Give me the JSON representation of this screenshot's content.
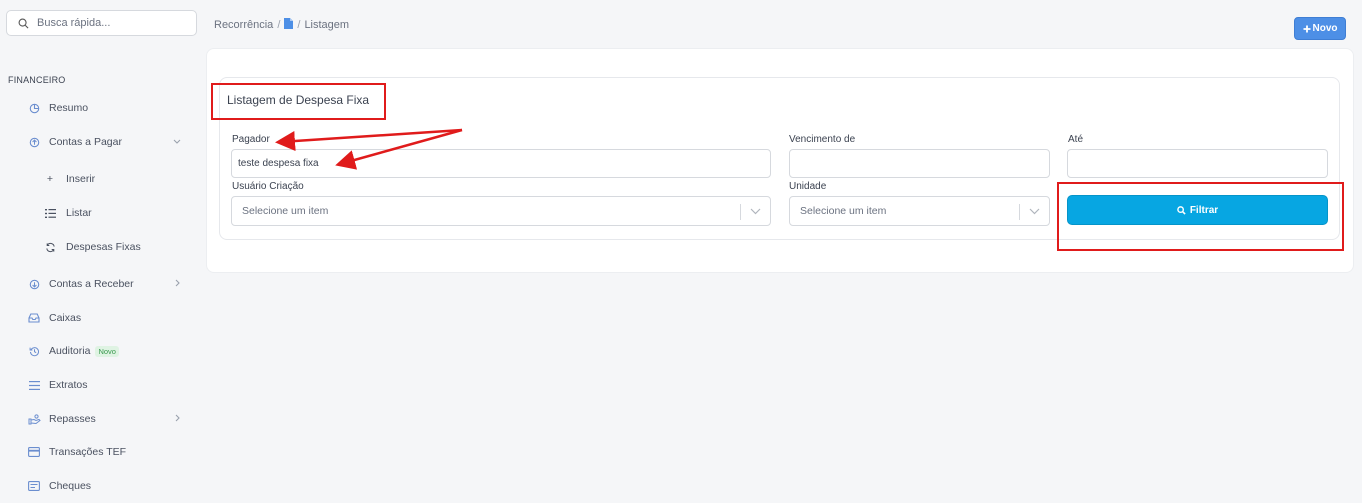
{
  "sidebar": {
    "search_placeholder": "Busca rápida...",
    "section_title": "FINANCEIRO",
    "items": {
      "resumo": "Resumo",
      "contas_pagar": "Contas a Pagar",
      "inserir": "Inserir",
      "listar": "Listar",
      "despesas_fixas": "Despesas Fixas",
      "contas_receber": "Contas a Receber",
      "caixas": "Caixas",
      "auditoria": "Auditoria",
      "auditoria_badge": "Novo",
      "extratos": "Extratos",
      "repasses": "Repasses",
      "transacoes_tef": "Transações TEF",
      "cheques": "Cheques"
    }
  },
  "header": {
    "breadcrumb_1": "Recorrência",
    "breadcrumb_sep": "/",
    "breadcrumb_3": "Listagem",
    "new_button": "Novo"
  },
  "form": {
    "title": "Listagem de Despesa Fixa",
    "pagador_label": "Pagador",
    "pagador_value": "teste despesa fixa",
    "vencimento_label": "Vencimento de",
    "ate_label": "Até",
    "usuario_label": "Usuário Criação",
    "usuario_placeholder": "Selecione um item",
    "unidade_label": "Unidade",
    "unidade_placeholder": "Selecione um item",
    "filter_button": "Filtrar"
  },
  "colors": {
    "accent": "#4d8fe6",
    "filter_button": "#07a6e2",
    "annotation": "#e01b1b"
  }
}
